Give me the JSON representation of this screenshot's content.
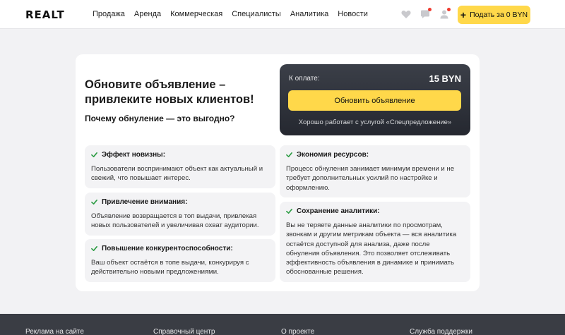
{
  "header": {
    "logo": "REALT",
    "nav": [
      "Продажа",
      "Аренда",
      "Коммерческая",
      "Специалисты",
      "Аналитика",
      "Новости"
    ],
    "icons": [
      "heart-icon",
      "chat-icon",
      "user-icon"
    ],
    "submit_label": "Подать за 0 BYN"
  },
  "main": {
    "title": "Обновите объявление – привлеките новых клиентов!",
    "subtitle": "Почему обнуление — это выгодно?",
    "payment": {
      "label": "К оплате:",
      "amount": "15 BYN",
      "button": "Обновить объявление",
      "note": "Хорошо работает с услугой «Спецпредложение»"
    },
    "features_left": [
      {
        "title": "Эффект новизны:",
        "text": "Пользователи воспринимают объект как актуальный и свежий, что повышает интерес."
      },
      {
        "title": "Привлечение внимания:",
        "text": "Объявление возвращается в топ выдачи, привлекая новых пользователей и увеличивая охват аудитории."
      },
      {
        "title": "Повышение конкурентоспособности:",
        "text": "Ваш объект остаётся в топе выдачи, конкурируя с действительно новыми предложениями."
      }
    ],
    "features_right": [
      {
        "title": "Экономия ресурсов:",
        "text": "Процесс обнуления занимает минимум времени и не требует дополнительных усилий по настройке и оформлению."
      },
      {
        "title": "Сохранение аналитики:",
        "text": "Вы не теряете данные аналитики по просмотрам, звонкам и другим метрикам объекта — вся аналитика остаётся доступной для анализа, даже после обнуления объявления. Это позволяет отслеживать эффективность объявления в динамике и принимать обоснованные решения."
      }
    ]
  },
  "footer": {
    "links": [
      "Реклама на сайте",
      "Справочный центр",
      "О проекте",
      "Служба поддержки"
    ]
  },
  "colors": {
    "accent": "#ffd84a",
    "check": "#2e9d45",
    "dark_panel": "#2d3038",
    "footer": "#3a3d44"
  }
}
